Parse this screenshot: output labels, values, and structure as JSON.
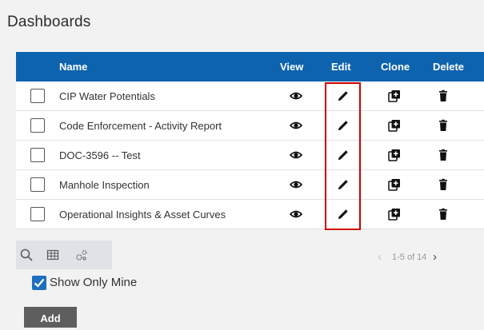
{
  "page": {
    "title": "Dashboards"
  },
  "table": {
    "columns": {
      "name": "Name",
      "view": "View",
      "edit": "Edit",
      "clone": "Clone",
      "delete": "Delete"
    },
    "rows": [
      {
        "name": "CIP Water Potentials"
      },
      {
        "name": "Code Enforcement - Activity Report"
      },
      {
        "name": "DOC-3596 -- Test"
      },
      {
        "name": "Manhole Inspection"
      },
      {
        "name": "Operational Insights & Asset Curves"
      }
    ],
    "icons": {
      "view": "eye-icon",
      "edit": "pencil-icon",
      "clone": "clone-icon",
      "delete": "trash-icon"
    }
  },
  "toolbar": {
    "icons": [
      "search-icon",
      "table-icon",
      "settings-icon"
    ]
  },
  "pager": {
    "text": "1-5 of 14"
  },
  "filter": {
    "show_only_mine_label": "Show Only Mine",
    "show_only_mine_checked": true
  },
  "actions": {
    "add_label": "Add"
  },
  "colors": {
    "header": "#0e63ae",
    "highlight": "#d10000",
    "checkbox": "#1e6ec0"
  }
}
